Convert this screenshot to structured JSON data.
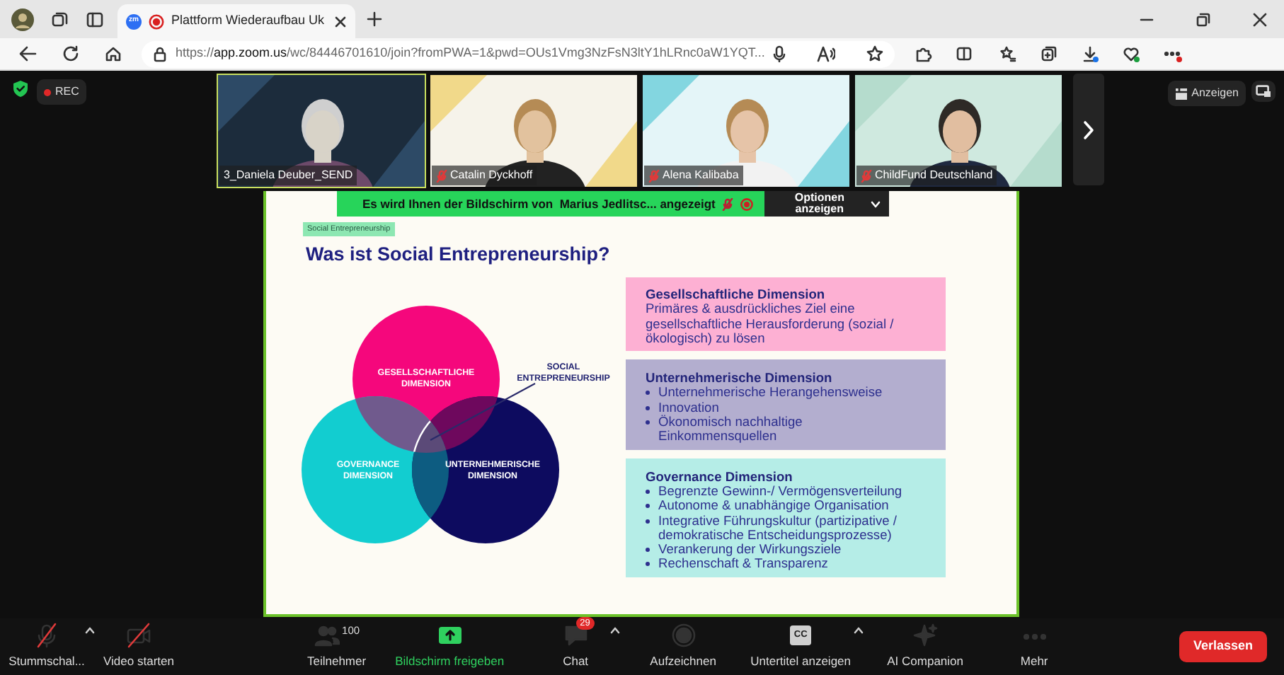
{
  "browser": {
    "tabs": [
      {
        "favicon_text": "zm",
        "title": "Plattform Wiederaufbau Uk",
        "recording": true,
        "selected": true
      }
    ],
    "url": "https://**app.zoom.us**/wc/84446701610/join?fromPWA=1&pwd=OUs1Vmg3NzFsN3ltY1hLRnc0aW1YQT..."
  },
  "meeting": {
    "recording_label": "REC",
    "view_button": "Anzeigen",
    "participants": [
      {
        "name": "3_Daniela Deuber_SEND",
        "muted": false,
        "speaking": true
      },
      {
        "name": "Catalin Dyckhoff",
        "muted": true,
        "speaking": false
      },
      {
        "name": "Alena Kalibaba",
        "muted": true,
        "speaking": false
      },
      {
        "name": "ChildFund Deutschland",
        "muted": true,
        "speaking": false
      }
    ],
    "share_banner": {
      "text": "Es wird Ihnen der Bildschirm von  Marius Jedlitsc... angezeigt",
      "options": "Optionen anzeigen"
    }
  },
  "slide": {
    "tag": "Social Entrepreneurship",
    "title": "Was ist Social Entrepreneurship?",
    "venn": [
      {
        "label": "GESELLSCHAFTLICHE DIMENSION",
        "color": "#f5077c"
      },
      {
        "label": "GOVERNANCE DIMENSION",
        "color": "#12cdd0"
      },
      {
        "label": "UNTERNEHMERISCHE DIMENSION",
        "color": "#0d0b5f"
      }
    ],
    "center_label": "SOCIAL ENTREPRENEURSHIP",
    "boxes": [
      {
        "kind": "paragraph",
        "color": "#fdb0d3",
        "title": "Gesellschaftliche Dimension",
        "text": "Primäres & ausdrückliches Ziel eine gesellschaftliche Herausforderung (sozial / ökologisch) zu lösen"
      },
      {
        "kind": "bullets",
        "color": "#b3aecf",
        "title": "Unternehmerische Dimension",
        "bullets": [
          "Unternehmerische Herangehensweise",
          "Innovation",
          "Ökonomisch nachhaltige Einkommensquellen"
        ]
      },
      {
        "kind": "bullets",
        "color": "#b5ede7",
        "title": "Governance Dimension",
        "bullets": [
          "Begrenzte Gewinn-/ Vermögensverteilung",
          "Autonome & unabhängige Organisation",
          "Integrative Führungskultur (partizipative / demokratische Entscheidungsprozesse)",
          "Verankerung der Wirkungsziele",
          "Rechenschaft & Transparenz"
        ]
      }
    ]
  },
  "toolbar": {
    "items": [
      {
        "kind": "mic-off",
        "label": "Stummschal...",
        "has_menu": true
      },
      {
        "kind": "video-off",
        "label": "Video starten",
        "has_menu": false
      },
      {
        "kind": "participants",
        "label": "Teilnehmer",
        "count": "100",
        "has_menu": false
      },
      {
        "kind": "share",
        "label": "Bildschirm freigeben",
        "active": true,
        "has_menu": false
      },
      {
        "kind": "chat",
        "label": "Chat",
        "badge": "29",
        "has_menu": true
      },
      {
        "kind": "record",
        "label": "Aufzeichnen",
        "has_menu": false
      },
      {
        "kind": "captions",
        "label": "Untertitel anzeigen",
        "icon_text": "CC",
        "has_menu": true
      },
      {
        "kind": "ai",
        "label": "AI Companion",
        "has_menu": false
      },
      {
        "kind": "more",
        "label": "Mehr",
        "has_menu": false
      }
    ],
    "leave": "Verlassen"
  }
}
